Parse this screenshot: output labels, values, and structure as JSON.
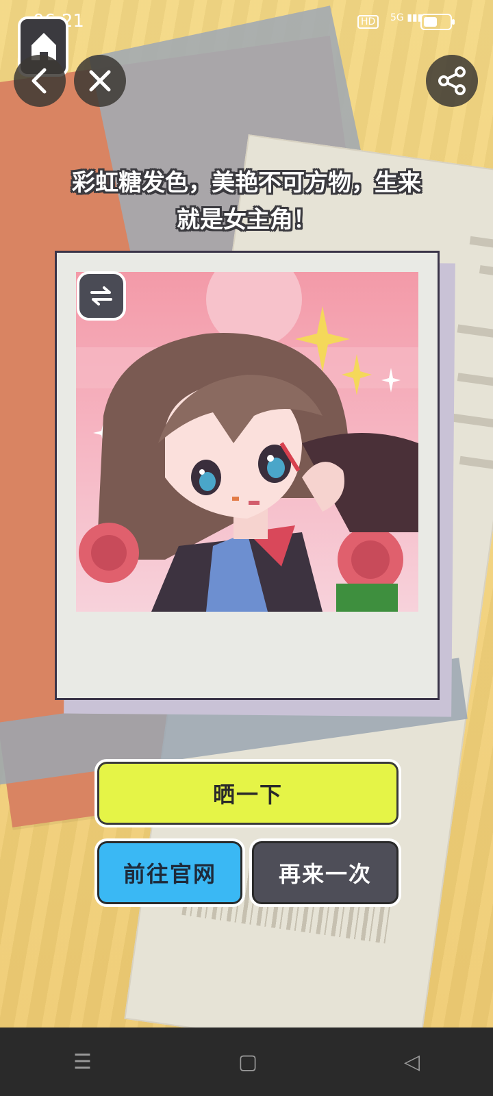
{
  "status_bar": {
    "time": "06:21",
    "hd": "HD",
    "network": "5G",
    "battery_level": 0.55
  },
  "header": {
    "home_icon": "home-icon",
    "back_icon": "back-icon",
    "close_icon": "close-icon",
    "share_icon": "share-icon"
  },
  "caption": {
    "line1": "彩虹糖发色，美艳不可方物，生来",
    "line2": "就是女主角！"
  },
  "photo": {
    "swap_icon": "swap-icon"
  },
  "buttons": {
    "share_label": "晒一下",
    "website_label": "前往官网",
    "retry_label": "再来一次"
  },
  "system_nav": {
    "menu": "☰",
    "home": "▢",
    "back": "◁"
  },
  "colors": {
    "share_button": "#e5f447",
    "website_button": "#3ab8f4",
    "retry_button": "#4e4e58"
  }
}
